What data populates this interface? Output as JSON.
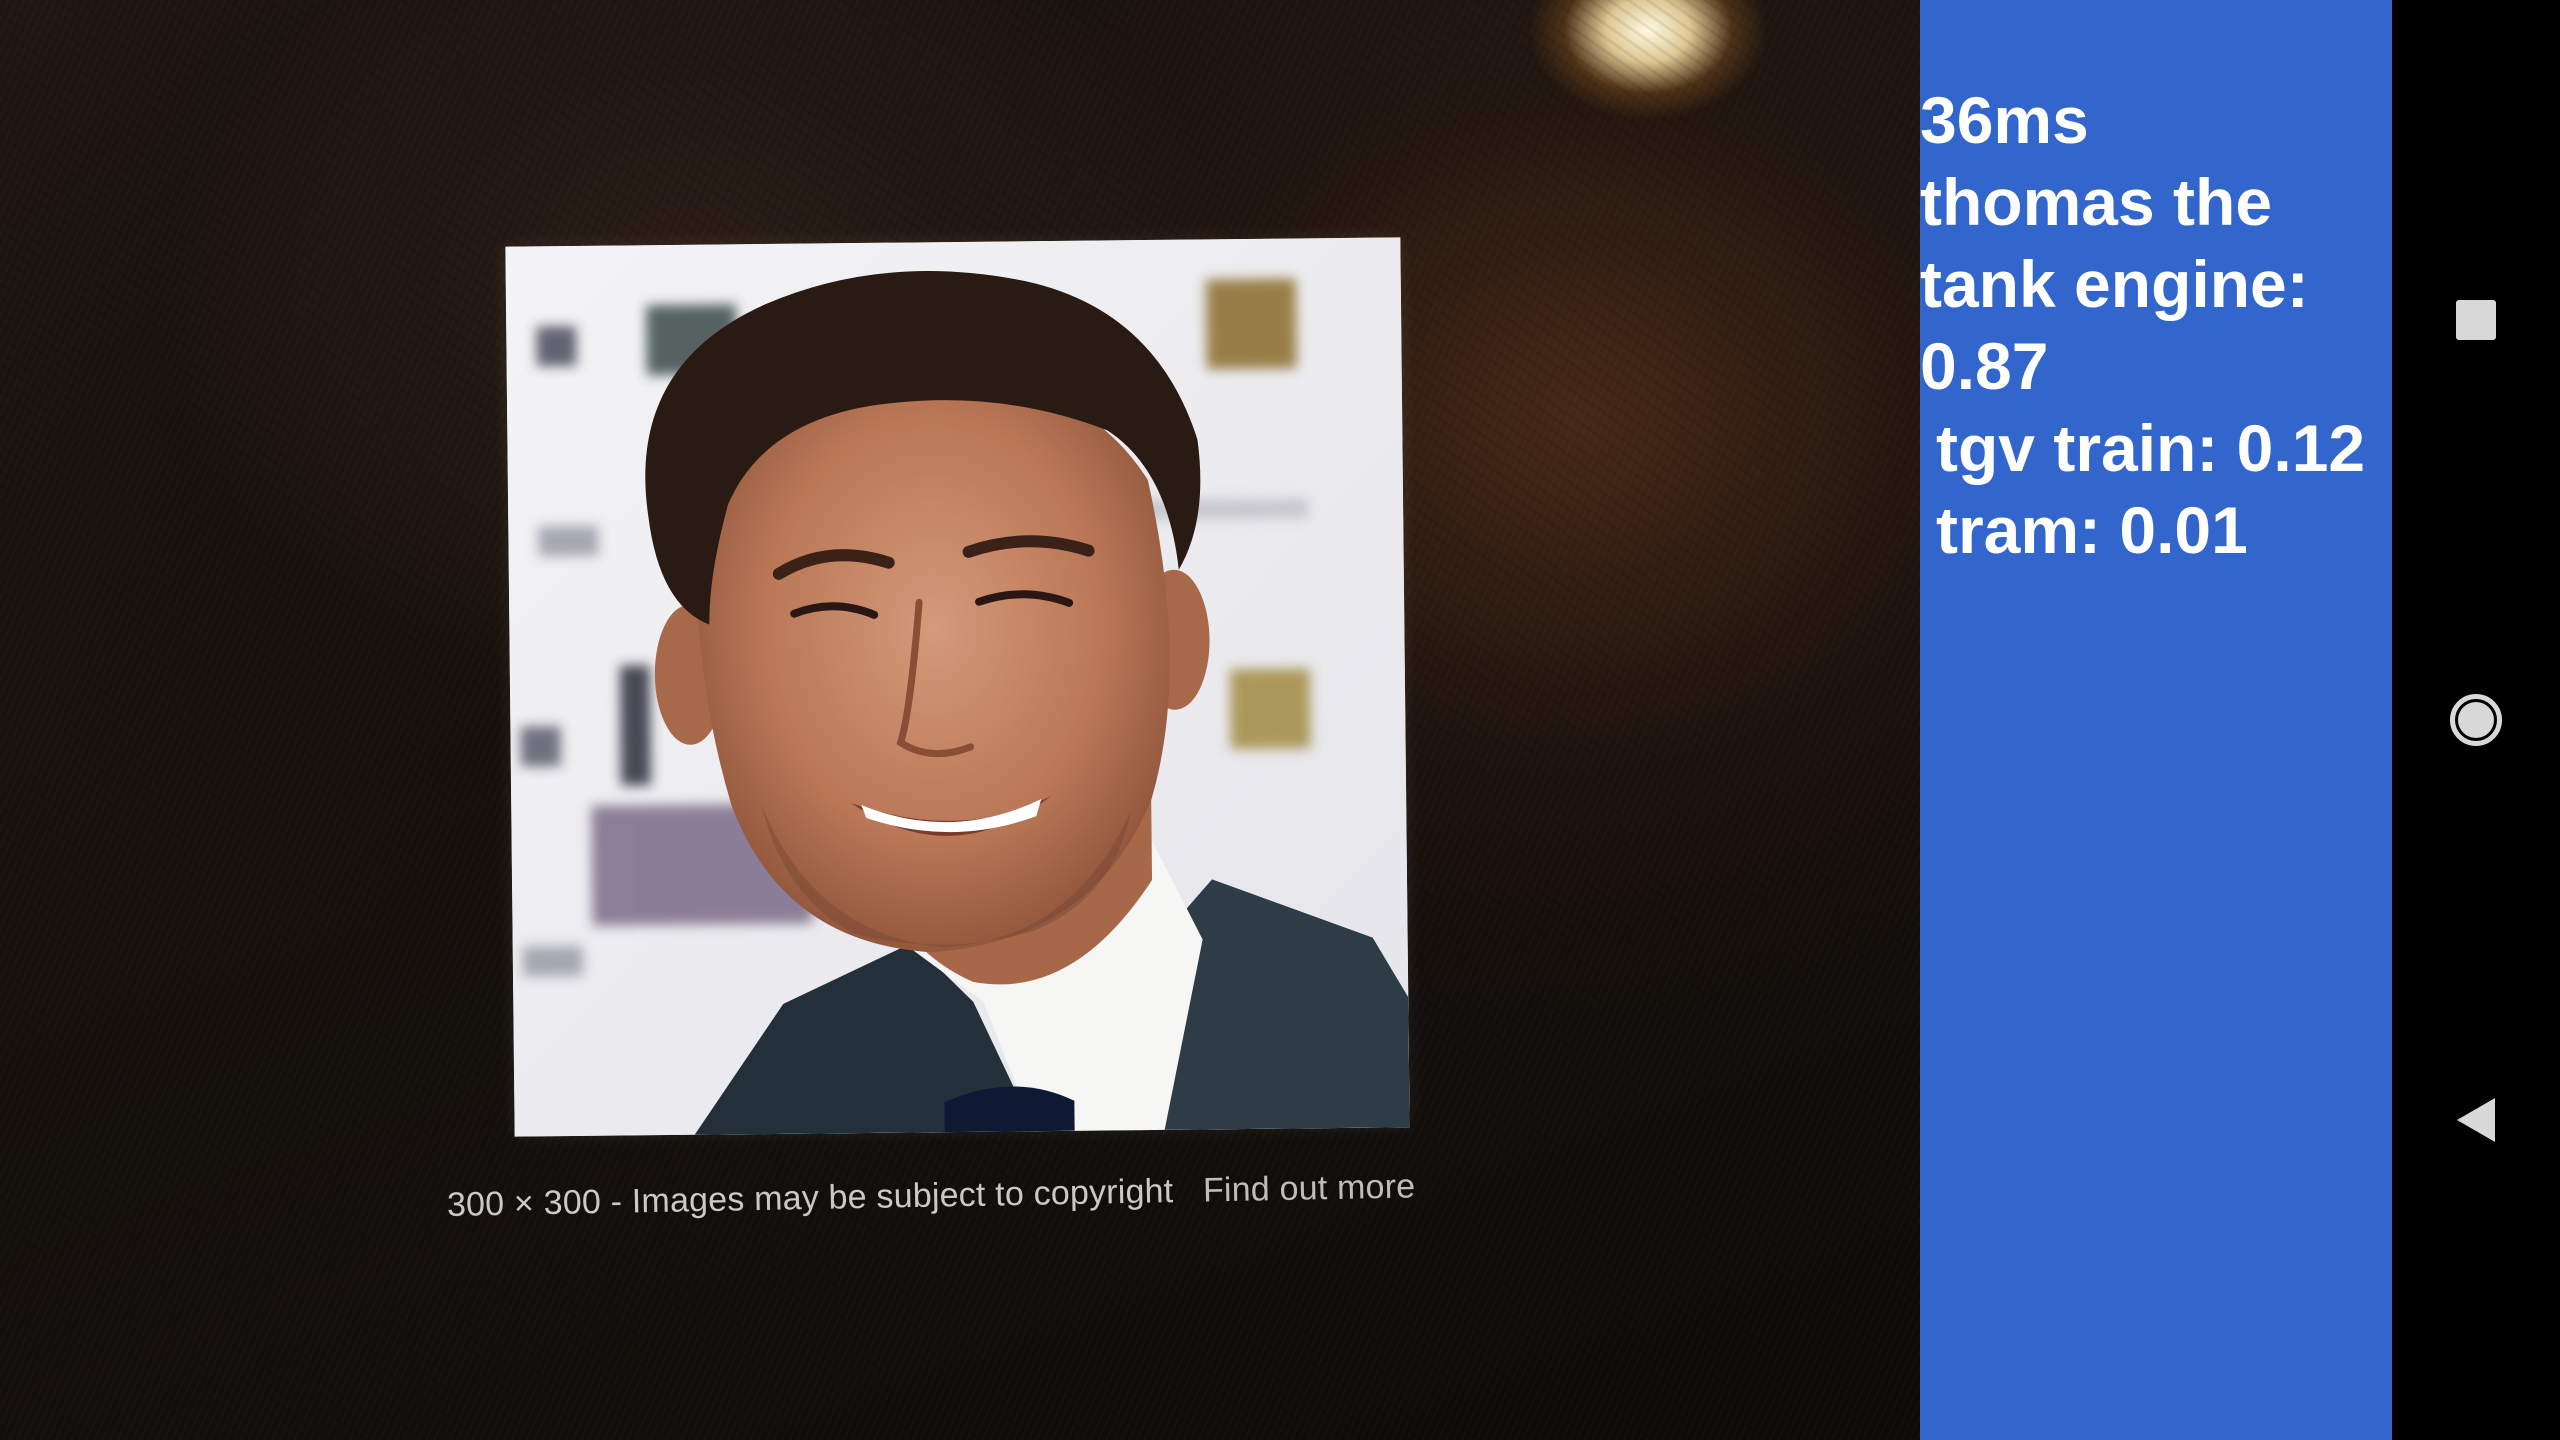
{
  "camera": {
    "caption_size": "300 × 300",
    "caption_separator": "-",
    "caption_notice": "Images may be subject to copyright",
    "caption_link": "Find out more"
  },
  "results": {
    "inference_time": "36ms",
    "top_label_line1": "thomas the",
    "top_label_line2": "tank engine:",
    "top_score": "0.87",
    "second": "tgv train: 0.12",
    "third": "tram: 0.01"
  },
  "nav": {
    "recent_icon": "square-icon",
    "home_icon": "circle-icon",
    "back_icon": "triangle-back-icon"
  },
  "colors": {
    "panel_background": "#3366cc",
    "panel_text": "#ffffff",
    "nav_background": "#000000",
    "nav_icons": "#d8d8d8"
  }
}
